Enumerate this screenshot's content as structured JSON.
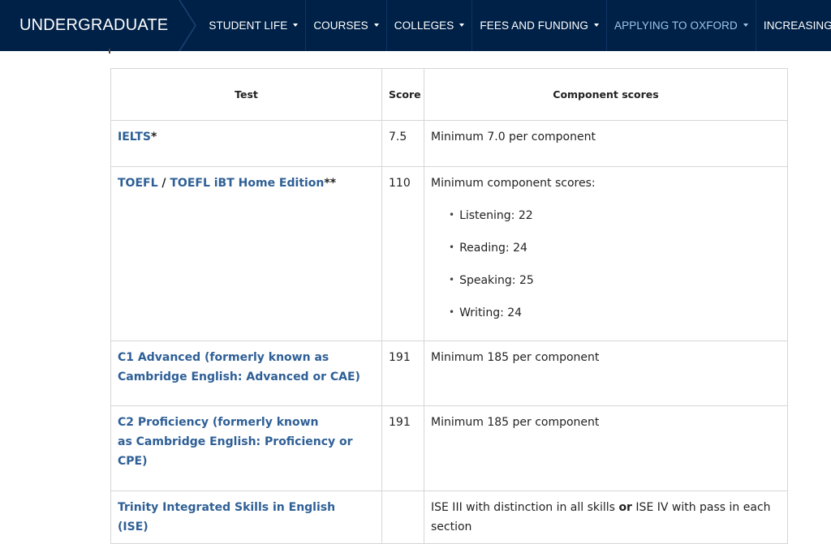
{
  "nav": {
    "brand": "UNDERGRADUATE",
    "items": [
      {
        "label": "STUDENT LIFE",
        "active": false
      },
      {
        "label": "COURSES",
        "active": false
      },
      {
        "label": "COLLEGES",
        "active": false
      },
      {
        "label": "FEES AND FUNDING",
        "active": false
      },
      {
        "label": "APPLYING TO OXFORD",
        "active": true
      },
      {
        "label": "INCREASING ACCESS",
        "active": false
      }
    ],
    "colors": {
      "background": "#002147",
      "active": "#9ec5ec"
    }
  },
  "table": {
    "headers": {
      "test": "Test",
      "score": "Score",
      "components": "Component scores"
    },
    "rows": [
      {
        "test": {
          "link": "IELTS",
          "suffix": "*"
        },
        "score": "7.5",
        "components": {
          "text": "Minimum 7.0 per component"
        }
      },
      {
        "test": {
          "link": "TOEFL",
          "sep": " / ",
          "link2": "TOEFL iBT Home Edition",
          "suffix": "**"
        },
        "score": "110",
        "components": {
          "text": "Minimum component scores:",
          "list": [
            "Listening: 22",
            "Reading: 24",
            "Speaking: 25",
            "Writing: 24"
          ]
        }
      },
      {
        "test": {
          "line1": "C1 Advanced (formerly known as",
          "line2": "Cambridge English: Advanced or CAE)"
        },
        "score": "191",
        "components": {
          "text": "Minimum 185 per component"
        }
      },
      {
        "test": {
          "line1": "C2 Proficiency (formerly known",
          "line2": "as Cambridge English: Proficiency or",
          "line3": "CPE)"
        },
        "score": "191",
        "components": {
          "text": "Minimum 185 per component"
        }
      },
      {
        "test": {
          "line1": "Trinity Integrated Skills in English",
          "line2": "(ISE)"
        },
        "score": "",
        "components": {
          "part1": "ISE III with distinction in all skills",
          "or": "or",
          "part2": "ISE IV with pass in each",
          "line2": "section"
        }
      }
    ]
  }
}
